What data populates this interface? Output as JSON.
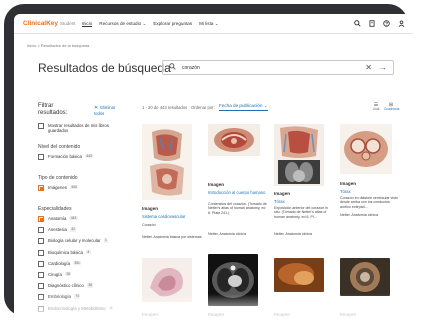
{
  "app": {
    "brand": "ClinicalKey",
    "brand_sub": "Student"
  },
  "nav": {
    "items": [
      "Inicio",
      "Recursos de estudio ⌄",
      "Explorar preguntas",
      "Mi lista ⌄"
    ],
    "icons": [
      "search-icon",
      "bookmark-icon",
      "help-icon",
      "user-icon"
    ]
  },
  "breadcrumb": "Inicio  >  Resultados de la búsqueda",
  "page_title": "Resultados de búsqueda",
  "search": {
    "value": "corazón",
    "clear_glyph": "✕",
    "go_glyph": "→"
  },
  "filters": {
    "heading": "Filtrar resultados:",
    "clear": "Eliminar todos",
    "exam_option": "Mostrar resultados de mis libros guardados",
    "level_title": "Nivel del contenido",
    "level_option": {
      "label": "Formación básica",
      "count": "443"
    },
    "type_title": "Tipo de contenido",
    "type_option": {
      "label": "Imágenes",
      "count": "443"
    },
    "specialties_title": "Especialidades",
    "specialties": [
      {
        "label": "Anatomía",
        "count": "443",
        "checked": true
      },
      {
        "label": "Anestesia",
        "count": "42",
        "checked": false
      },
      {
        "label": "Biología celular y molecular",
        "count": "1",
        "checked": false
      },
      {
        "label": "Bioquímica básica",
        "count": "4",
        "checked": false
      },
      {
        "label": "Cardiología",
        "count": "351",
        "checked": false
      },
      {
        "label": "Cirugía",
        "count": "28",
        "checked": false
      },
      {
        "label": "Diagnóstico clínico",
        "count": "38",
        "checked": false
      },
      {
        "label": "Embriología",
        "count": "74",
        "checked": false
      },
      {
        "label": "Endocrinología y Metabolismo",
        "count": "4",
        "checked": false
      }
    ]
  },
  "results": {
    "count": "1 - 20 de 443 resultados",
    "sort_label": "Ordenar por:",
    "sort_value": "Fecha de publicación ⌄",
    "view_list": "Lista",
    "view_grid": "Cuadrícula",
    "cards": [
      {
        "type": "Imagen",
        "title": "Sistema cardiovascular",
        "desc": "Corazón",
        "source": "Netter. Anatomía básica por sistemas"
      },
      {
        "type": "Imagen",
        "title": "Introducción al cuerpo humano",
        "desc": "Contenidos del corazón. (Tomado de Netter's atlas of human anatomy, ed 6, Plate 241.)",
        "source": "Netter. Anatomía clínica"
      },
      {
        "type": "Imagen",
        "title": "Tórax",
        "desc": "Exposición anterior del corazón in situ. (Tomado de Netter's atlas of human anatomy, ed 6, Pl...",
        "source": "Netter. Anatomía clínica"
      },
      {
        "type": "Imagen",
        "title": "Tórax",
        "desc": "Corazón en diástole ventricular visto desde arriba con los conductos aórtico extirpad...",
        "source": "Netter. Anatomía clínica"
      },
      {
        "type": "Imagen"
      },
      {
        "type": "Imagen"
      },
      {
        "type": "Imagen"
      },
      {
        "type": "Imagen"
      }
    ]
  },
  "colors": {
    "brand_orange": "#e9711c",
    "link_blue": "#1f6fb2",
    "device_frame": "#2f3033"
  }
}
